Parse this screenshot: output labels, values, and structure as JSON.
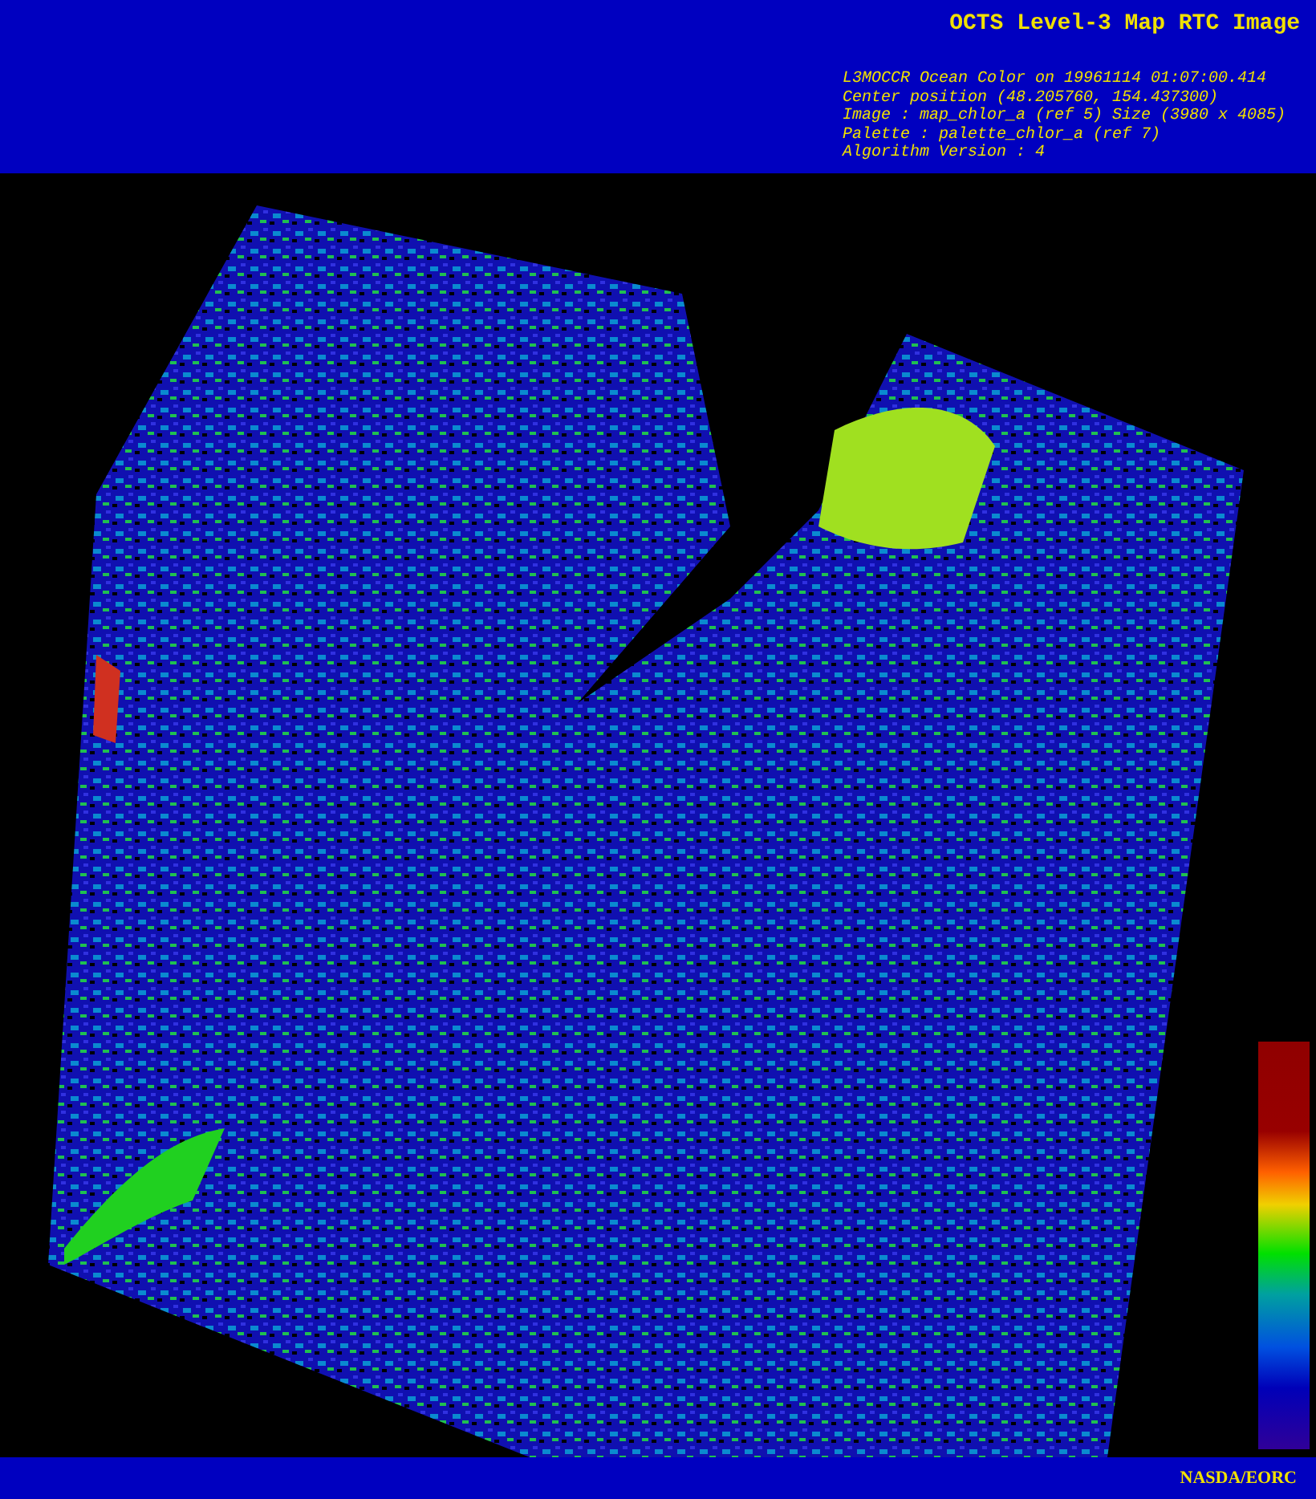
{
  "header": {
    "title": "OCTS Level-3 Map RTC Image",
    "info_lines": [
      "L3MOCCR Ocean Color on 19961114 01:07:00.414",
      "Center position (48.205760, 154.437300)",
      "Image : map_chlor_a (ref 5) Size (3980 x 4085)",
      "Palette : palette_chlor_a (ref 7)",
      "Algorithm Version : 4"
    ]
  },
  "footer": {
    "credit": "NASDA/EORC"
  }
}
